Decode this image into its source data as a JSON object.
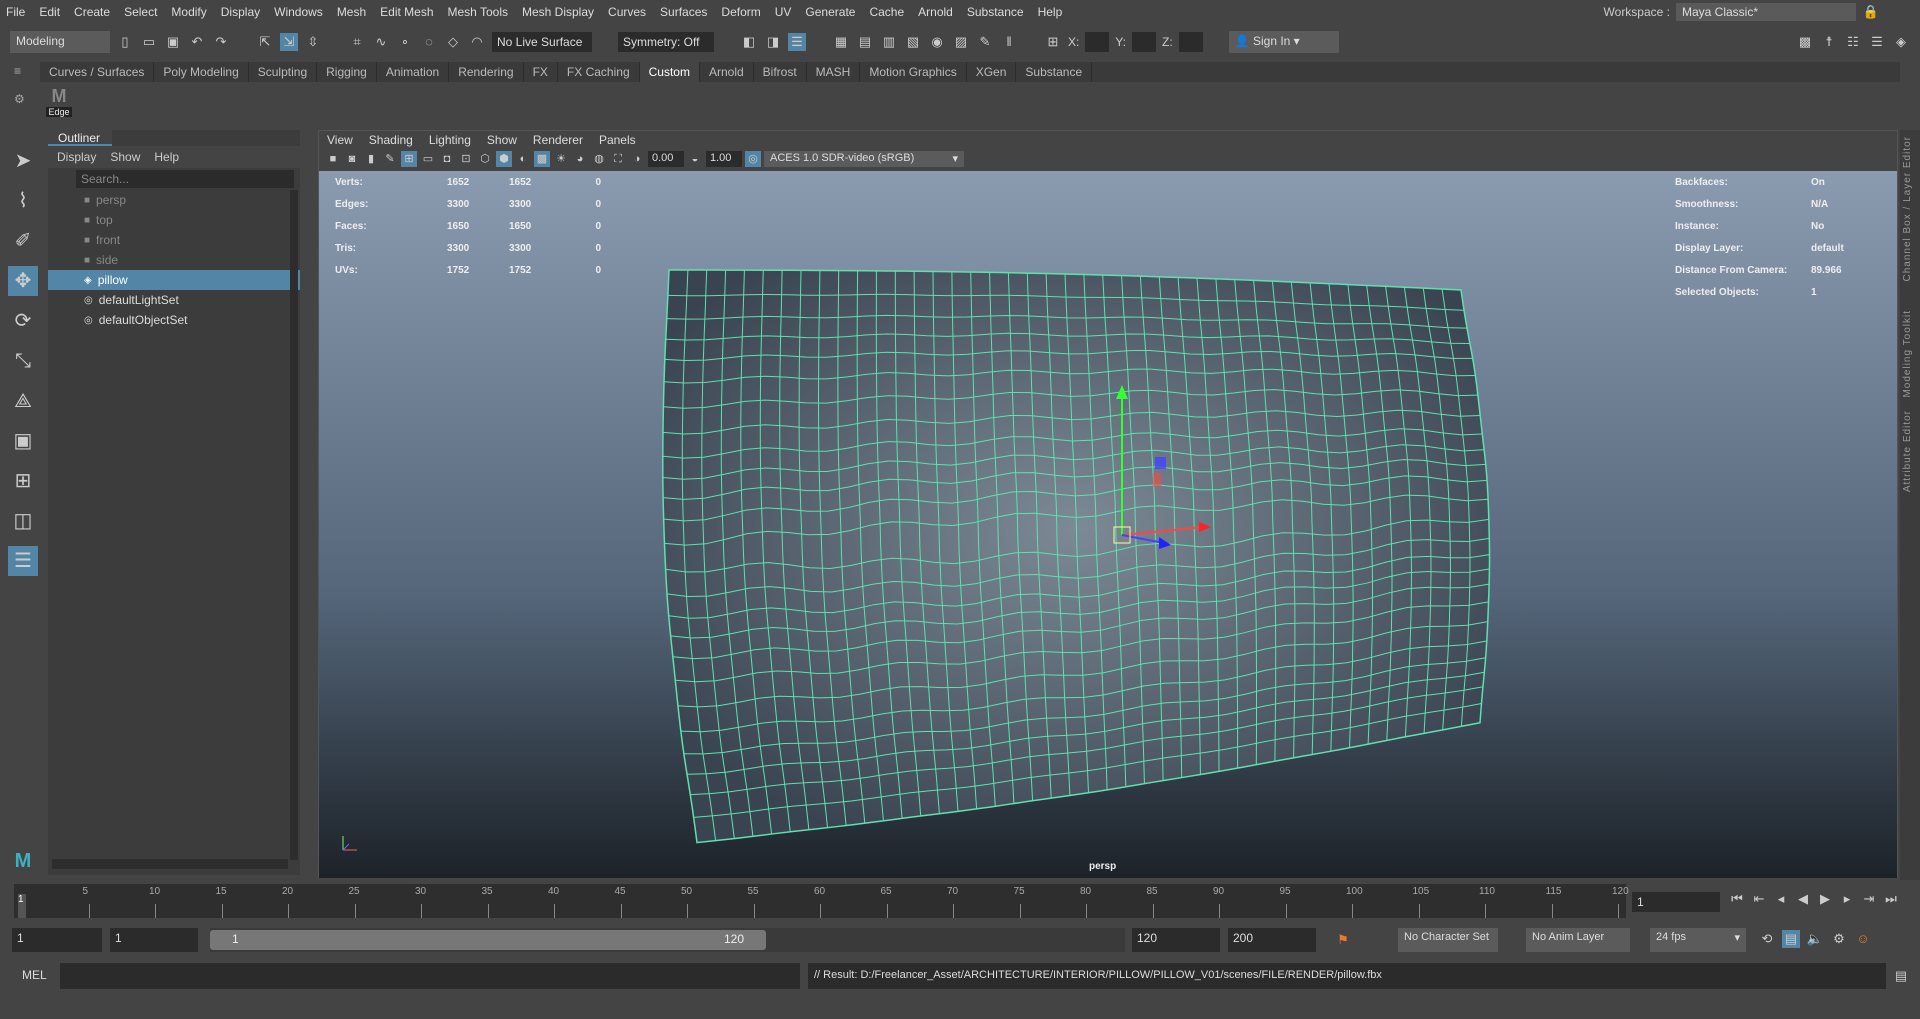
{
  "menubar": {
    "items": [
      "File",
      "Edit",
      "Create",
      "Select",
      "Modify",
      "Display",
      "Windows",
      "Mesh",
      "Edit Mesh",
      "Mesh Tools",
      "Mesh Display",
      "Curves",
      "Surfaces",
      "Deform",
      "UV",
      "Generate",
      "Cache",
      "Arnold",
      "Substance",
      "Help"
    ],
    "workspace_label": "Workspace :",
    "workspace_value": "Maya Classic*"
  },
  "status": {
    "mode": "Modeling",
    "live_surface": "No Live Surface",
    "symmetry": "Symmetry: Off",
    "x_label": "X:",
    "y_label": "Y:",
    "z_label": "Z:",
    "sign_in": "Sign In"
  },
  "shelf": {
    "tabs": [
      "Curves / Surfaces",
      "Poly Modeling",
      "Sculpting",
      "Rigging",
      "Animation",
      "Rendering",
      "FX",
      "FX Caching",
      "Custom",
      "Arnold",
      "Bifrost",
      "MASH",
      "Motion Graphics",
      "XGen",
      "Substance"
    ],
    "active": "Custom",
    "button_label": "Edge"
  },
  "outliner": {
    "title": "Outliner",
    "menu": [
      "Display",
      "Show",
      "Help"
    ],
    "search_placeholder": "Search...",
    "items": [
      {
        "label": "persp",
        "icon": "camera-icon",
        "dim": true
      },
      {
        "label": "top",
        "icon": "camera-icon",
        "dim": true
      },
      {
        "label": "front",
        "icon": "camera-icon",
        "dim": true
      },
      {
        "label": "side",
        "icon": "camera-icon",
        "dim": true
      },
      {
        "label": "pillow",
        "icon": "mesh-icon",
        "selected": true
      },
      {
        "label": "defaultLightSet",
        "icon": "set-icon"
      },
      {
        "label": "defaultObjectSet",
        "icon": "set-icon"
      }
    ]
  },
  "viewport": {
    "menu": [
      "View",
      "Shading",
      "Lighting",
      "Show",
      "Renderer",
      "Panels"
    ],
    "exposure": "0.00",
    "gamma": "1.00",
    "color_space": "ACES 1.0 SDR-video (sRGB)",
    "camera": "persp",
    "stats": [
      [
        "Verts:",
        "1652",
        "1652",
        "0"
      ],
      [
        "Edges:",
        "3300",
        "3300",
        "0"
      ],
      [
        "Faces:",
        "1650",
        "1650",
        "0"
      ],
      [
        "Tris:",
        "3300",
        "3300",
        "0"
      ],
      [
        "UVs:",
        "1752",
        "1752",
        "0"
      ]
    ],
    "info": [
      [
        "Backfaces:",
        "On"
      ],
      [
        "Smoothness:",
        "N/A"
      ],
      [
        "Instance:",
        "No"
      ],
      [
        "Display Layer:",
        "default"
      ],
      [
        "Distance From Camera:",
        "89.966"
      ],
      [
        "Selected Objects:",
        "1"
      ]
    ],
    "wire_color": "#5fe0b0"
  },
  "side_tabs": [
    "Channel Box / Layer Editor",
    "Modeling Toolkit",
    "Attribute Editor"
  ],
  "timeline": {
    "ticks": [
      "5",
      "10",
      "15",
      "20",
      "25",
      "30",
      "35",
      "40",
      "45",
      "50",
      "55",
      "60",
      "65",
      "70",
      "75",
      "80",
      "85",
      "90",
      "95",
      "100",
      "105",
      "110",
      "115",
      "120"
    ],
    "current": "1",
    "current_frame_field": "1"
  },
  "range": {
    "start": "1",
    "playback_start": "1",
    "slider_start": "1",
    "slider_end": "120",
    "playback_end": "120",
    "end": "200",
    "character_set": "No Character Set",
    "anim_layer": "No Anim Layer",
    "fps": "24 fps"
  },
  "command": {
    "lang": "MEL",
    "result": "// Result: D:/Freelancer_Asset/ARCHITECTURE/INTERIOR/PILLOW/PILLOW_V01/scenes/FILE/RENDER/pillow.fbx"
  }
}
